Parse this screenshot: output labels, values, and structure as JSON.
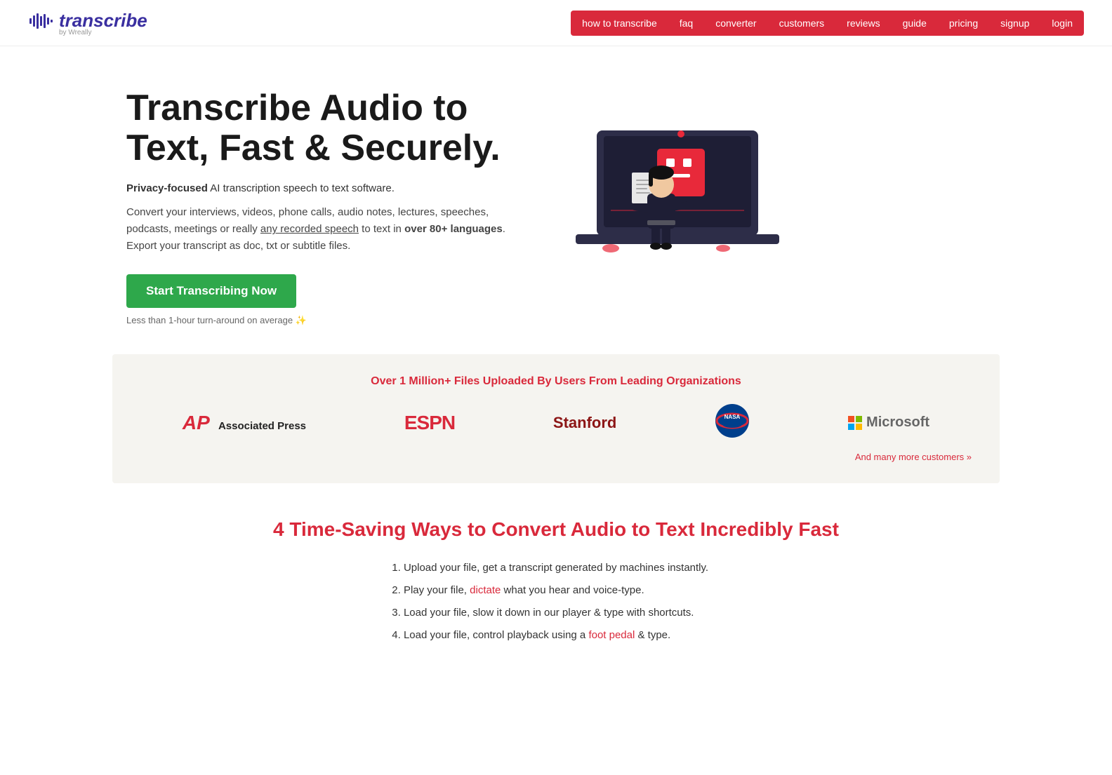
{
  "header": {
    "logo_text": "transcribe",
    "logo_by": "by Wreally",
    "nav_items": [
      {
        "label": "how to transcribe",
        "href": "#"
      },
      {
        "label": "faq",
        "href": "#"
      },
      {
        "label": "converter",
        "href": "#"
      },
      {
        "label": "customers",
        "href": "#"
      },
      {
        "label": "reviews",
        "href": "#"
      },
      {
        "label": "guide",
        "href": "#"
      },
      {
        "label": "pricing",
        "href": "#"
      },
      {
        "label": "signup",
        "href": "#"
      },
      {
        "label": "login",
        "href": "#"
      }
    ]
  },
  "hero": {
    "title": "Transcribe Audio to Text, Fast & Securely.",
    "subtitle_bold": "Privacy-focused",
    "subtitle_rest": " AI transcription speech to text software.",
    "description_before_link": "Convert your interviews, videos, phone calls, audio notes, lectures, speeches, podcasts, meetings or really ",
    "description_link": "any recorded speech",
    "description_after_link": " to text in ",
    "description_bold": "over 80+ languages",
    "description_end": ". Export your transcript as doc, txt or subtitle files.",
    "cta_label": "Start Transcribing Now",
    "cta_note": "Less than 1-hour turn-around on average ✨"
  },
  "logos": {
    "heading": "Over 1 Million+ Files Uploaded By Users From Leading Organizations",
    "items": [
      {
        "name": "Associated Press",
        "type": "ap"
      },
      {
        "name": "ESPN",
        "type": "espn"
      },
      {
        "name": "Stanford",
        "type": "stanford"
      },
      {
        "name": "NASA",
        "type": "nasa"
      },
      {
        "name": "Microsoft",
        "type": "microsoft"
      }
    ],
    "more_link": "And many more customers »"
  },
  "ways": {
    "title": "4 Time-Saving Ways to Convert Audio to Text Incredibly Fast",
    "items": [
      {
        "text_before": "Upload your file, get a transcript generated by machines instantly.",
        "link": null
      },
      {
        "text_before": "Play your file, ",
        "link_text": "dictate",
        "text_after": " what you hear and voice-type."
      },
      {
        "text_before": "Load your file, slow it down in our player & type with shortcuts.",
        "link": null
      },
      {
        "text_before": "Load your file, control playback using a ",
        "link_text": "foot pedal",
        "text_after": " & type."
      }
    ]
  }
}
